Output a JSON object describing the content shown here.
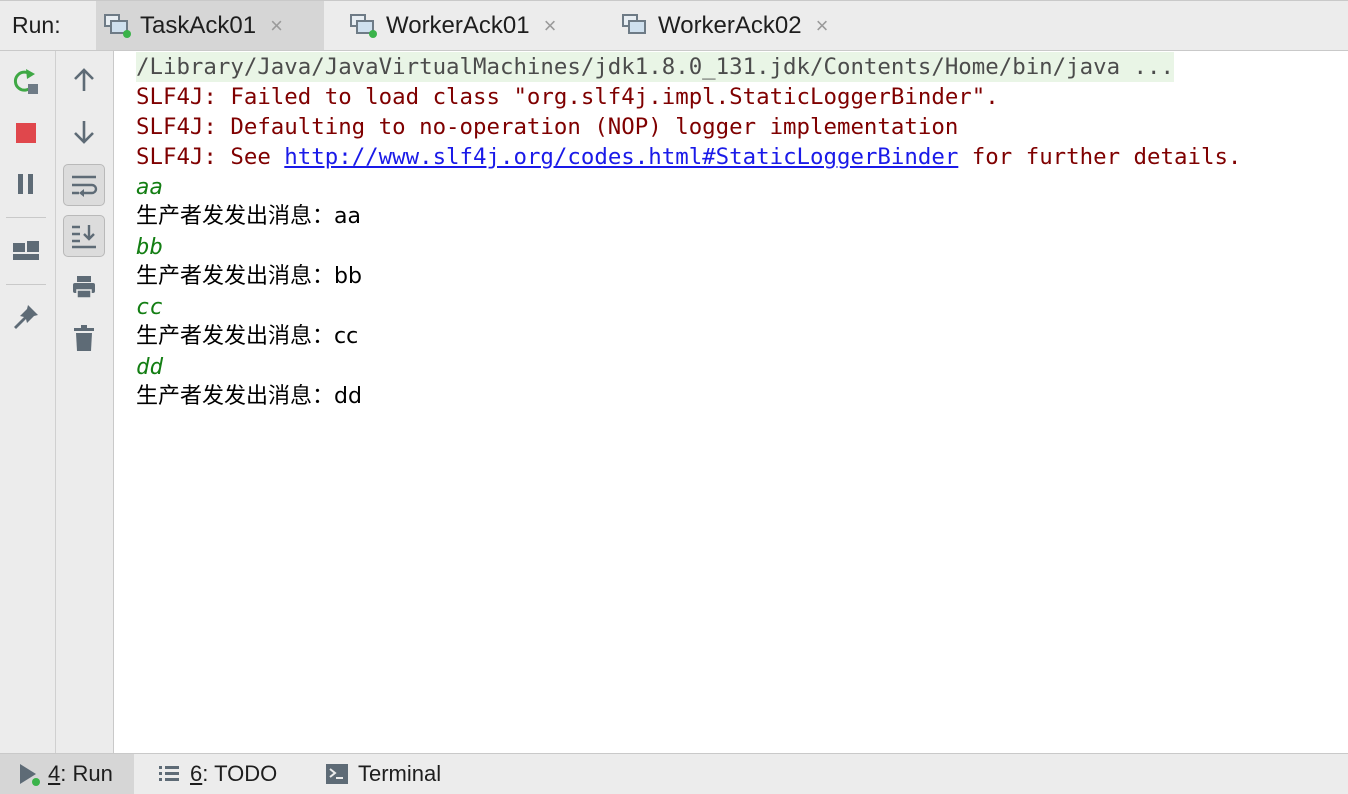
{
  "tabbar": {
    "run_label": "Run:",
    "tabs": [
      {
        "label": "TaskAck01",
        "close": "×"
      },
      {
        "label": "WorkerAck01",
        "close": "×"
      },
      {
        "label": "WorkerAck02",
        "close": "×"
      }
    ]
  },
  "toolbar_left": {
    "icons": [
      "rerun-icon",
      "stop-icon",
      "pause-icon",
      "layout-icon",
      "pin-icon"
    ]
  },
  "toolbar_right": {
    "icons": [
      "up-arrow-icon",
      "down-arrow-icon",
      "soft-wrap-icon",
      "scroll-to-end-icon",
      "print-icon",
      "trash-icon"
    ]
  },
  "console": {
    "command": "/Library/Java/JavaVirtualMachines/jdk1.8.0_131.jdk/Contents/Home/bin/java ...",
    "err1": "SLF4J: Failed to load class \"org.slf4j.impl.StaticLoggerBinder\".",
    "err2": "SLF4J: Defaulting to no-operation (NOP) logger implementation",
    "err3_prefix": "SLF4J: See ",
    "err3_link": "http://www.slf4j.org/codes.html#StaticLoggerBinder",
    "err3_suffix": " for further details.",
    "in1": "aa",
    "out1": "生产者发发出消息：aa",
    "in2": "bb",
    "out2": "生产者发发出消息：bb",
    "in3": "cc",
    "out3": "生产者发发出消息：cc",
    "in4": "dd",
    "out4": "生产者发发出消息：dd"
  },
  "bottombar": {
    "run": {
      "key": "4",
      "label": ": Run"
    },
    "todo": {
      "key": "6",
      "label": ": TODO"
    },
    "terminal": {
      "label": "Terminal"
    }
  },
  "colors": {
    "error": "#7f0000",
    "input": "#137e13",
    "link": "#1a1ae8",
    "stop": "#e0474c",
    "rerun": "#3fa845"
  }
}
